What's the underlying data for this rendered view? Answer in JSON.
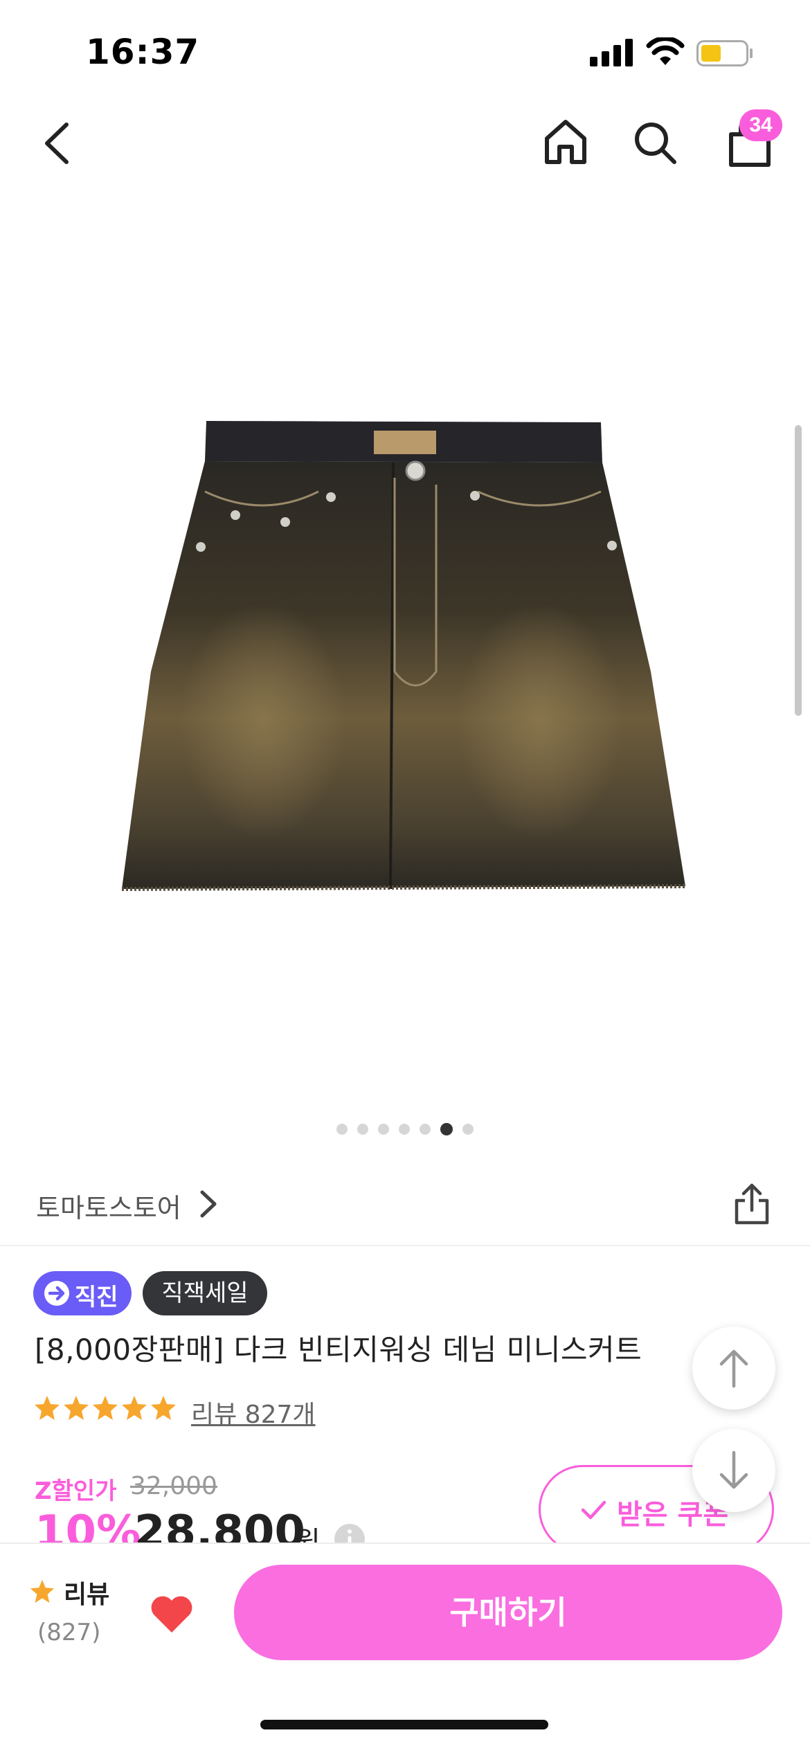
{
  "status_bar": {
    "time": "16:37"
  },
  "header": {
    "cart_count": "34"
  },
  "gallery": {
    "total_images": 7,
    "active_index": 5
  },
  "store": {
    "name": "토마토스토어"
  },
  "badges": {
    "zigzin": "직진",
    "sale": "직잭세일"
  },
  "product": {
    "title": "[8,000장판매] 다크 빈티지워싱 데님 미니스커트",
    "rating_stars": 5,
    "review_link": "리뷰 827개"
  },
  "price": {
    "z_label": "Z할인가",
    "original": "32,000",
    "discount": "10%",
    "sale": "28,800",
    "currency": "원"
  },
  "coupon": {
    "label": "받은 쿠폰"
  },
  "bottom_bar": {
    "review_label": "리뷰",
    "review_count": "(827)",
    "buy_label": "구매하기"
  },
  "colors": {
    "accent": "#fa5ddb",
    "zigzin": "#6a5cf6",
    "star": "#f7a62d",
    "heart": "#f2464a"
  }
}
